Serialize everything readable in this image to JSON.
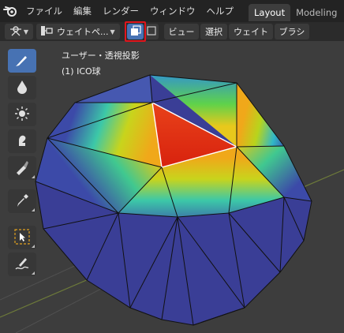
{
  "menubar": {
    "items": [
      "ファイル",
      "編集",
      "レンダー",
      "ウィンドウ",
      "ヘルプ"
    ],
    "workspaces": [
      "Layout",
      "Modeling"
    ],
    "active_workspace": "Layout"
  },
  "header": {
    "mode_label": "ウェイトペ...",
    "menus": [
      "ビュー",
      "選択",
      "ウェイト",
      "ブラシ"
    ],
    "icons": [
      "transform-pivot-icon",
      "weight-paint-mode-icon",
      "mask-face-icon",
      "mask-vertex-icon"
    ]
  },
  "viewport": {
    "view_label": "ユーザー・透視投影",
    "object_label": "(1) ICO球"
  },
  "toolbar": {
    "tools": [
      "draw-brush-icon",
      "blur-icon",
      "average-icon",
      "smear-icon",
      "gradient-icon",
      "sample-weight-icon",
      "select-box-icon",
      "annotate-icon"
    ],
    "active_tool": "draw-brush-icon"
  },
  "colors": {
    "menubar_bg": "#232323",
    "header_bg": "#2b2b2b",
    "viewport_bg": "#3d3d3d",
    "active_blue": "#4772b3",
    "highlight_red": "#e0141c",
    "weight_zero": "#3a3e96",
    "weight_full": "#e0281c"
  }
}
